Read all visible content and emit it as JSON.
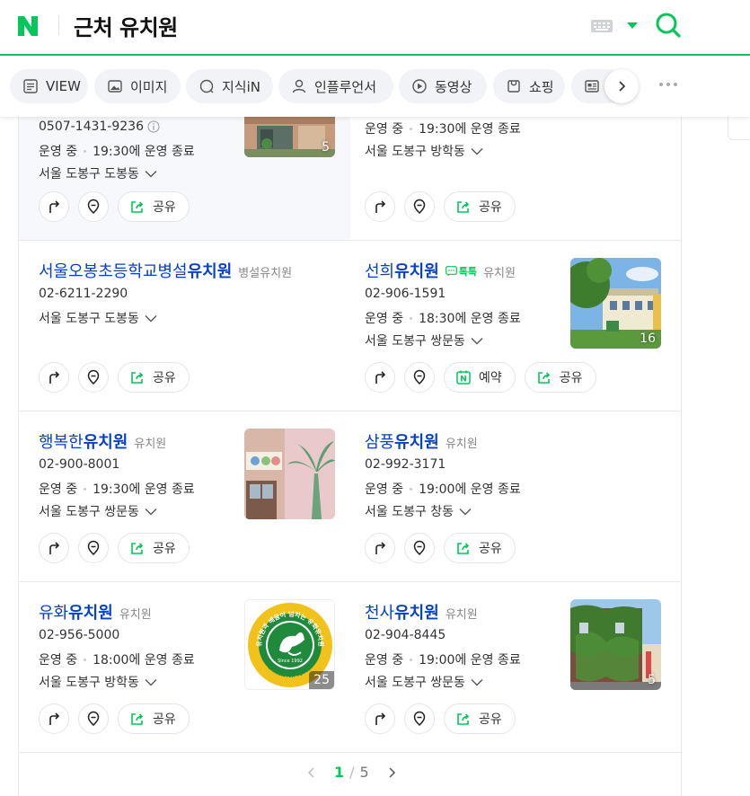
{
  "header": {
    "logo": "N",
    "query": "근처 유치원",
    "keyboard_icon": "keyboard-icon",
    "search_icon": "search-icon",
    "accent": "#03c75a"
  },
  "tabs": [
    {
      "label": "VIEW",
      "icon": "document-icon"
    },
    {
      "label": "이미지",
      "icon": "image-icon"
    },
    {
      "label": "지식iN",
      "icon": "knowledge-icon"
    },
    {
      "label": "인플루언서",
      "icon": "person-icon"
    },
    {
      "label": "동영상",
      "icon": "play-icon"
    },
    {
      "label": "쇼핑",
      "icon": "shopping-icon"
    },
    {
      "label": "",
      "icon": "news-icon"
    }
  ],
  "places": [
    {
      "name_pre": "",
      "name_bold": "",
      "name_post": "",
      "category": "",
      "phone": "0507-1431-9236",
      "status": "운영 중",
      "hours": "19:30에 운영 종료",
      "address": "서울 도봉구 도봉동",
      "photo_count": "5",
      "buttons": [
        "route",
        "map",
        "share"
      ]
    },
    {
      "name_pre": "",
      "name_bold": "",
      "name_post": "",
      "category": "",
      "phone": "",
      "status": "운영 중",
      "hours": "19:30에 운영 종료",
      "address": "서울 도봉구 방학동",
      "photo_count": "",
      "buttons": [
        "route",
        "map",
        "share"
      ]
    },
    {
      "name_pre": "서울오봉초등학교병설",
      "name_bold": "유치원",
      "name_post": "",
      "category": "병설유치원",
      "phone": "02-6211-2290",
      "status": "",
      "hours": "",
      "address": "서울 도봉구 도봉동",
      "photo_count": "",
      "buttons": [
        "route",
        "map",
        "share"
      ]
    },
    {
      "name_pre": "선희",
      "name_bold": "유치원",
      "name_post": "",
      "category": "유치원",
      "talk": "톡톡",
      "phone": "02-906-1591",
      "status": "운영 중",
      "hours": "18:30에 운영 종료",
      "address": "서울 도봉구 쌍문동",
      "photo_count": "16",
      "buttons": [
        "route",
        "map",
        "reserve",
        "share"
      ]
    },
    {
      "name_pre": "행복한",
      "name_bold": "유치원",
      "name_post": "",
      "category": "유치원",
      "phone": "02-900-8001",
      "status": "운영 중",
      "hours": "19:30에 운영 종료",
      "address": "서울 도봉구 쌍문동",
      "photo_count": "",
      "buttons": [
        "route",
        "map",
        "share"
      ]
    },
    {
      "name_pre": "삼풍",
      "name_bold": "유치원",
      "name_post": "",
      "category": "유치원",
      "phone": "02-992-3171",
      "status": "운영 중",
      "hours": "19:00에 운영 종료",
      "address": "서울 도봉구 창동",
      "photo_count": "",
      "buttons": [
        "route",
        "map",
        "share"
      ]
    },
    {
      "name_pre": "유화",
      "name_bold": "유치원",
      "name_post": "",
      "category": "유치원",
      "phone": "02-956-5000",
      "status": "운영 중",
      "hours": "18:00에 운영 종료",
      "address": "서울 도봉구 방학동",
      "photo_count": "25",
      "logo_text": "유치원과 배움이 넘치는 유화유치원",
      "logo_text2": "Since 1992",
      "logo_text3": "CHARACTER YUHWA",
      "buttons": [
        "route",
        "map",
        "share"
      ]
    },
    {
      "name_pre": "천사",
      "name_bold": "유치원",
      "name_post": "",
      "category": "유치원",
      "phone": "02-904-8445",
      "status": "운영 중",
      "hours": "19:00에 운영 종료",
      "address": "서울 도봉구 쌍문동",
      "photo_count": "5",
      "buttons": [
        "route",
        "map",
        "share"
      ]
    }
  ],
  "buttons": {
    "share": "공유",
    "reserve": "예약"
  },
  "pagination": {
    "current": "1",
    "separator": "/",
    "total": "5"
  }
}
